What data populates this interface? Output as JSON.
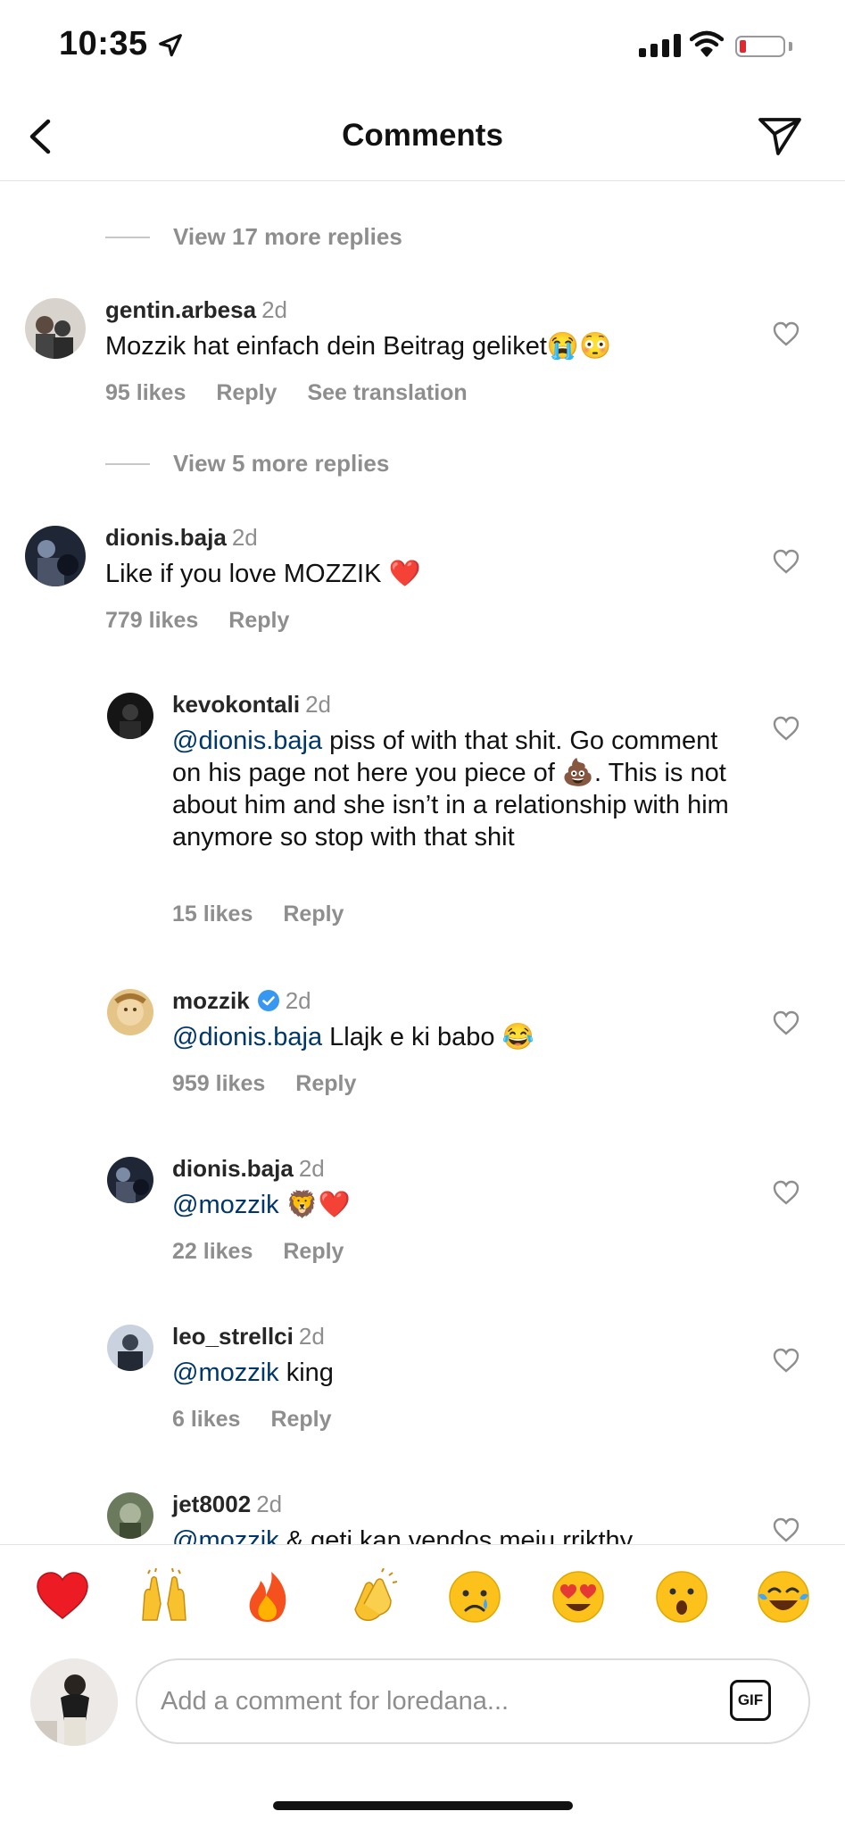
{
  "status": {
    "time": "10:35"
  },
  "header": {
    "title": "Comments"
  },
  "thread": [
    {
      "type": "more",
      "label": "View 17 more replies"
    },
    {
      "type": "comment",
      "username": "gentin.arbesa",
      "time": "2d",
      "text": [
        {
          "t": "Mozzik hat einfach dein Beitrag geliket😭😳"
        }
      ],
      "likes": "95 likes",
      "reply": "Reply",
      "translate": "See translation"
    },
    {
      "type": "more",
      "label": "View 5 more replies"
    },
    {
      "type": "comment",
      "username": "dionis.baja",
      "time": "2d",
      "text": [
        {
          "t": "Like if you love MOZZIK ❤️"
        }
      ],
      "likes": "779 likes",
      "reply": "Reply"
    },
    {
      "type": "reply",
      "username": "kevokontali",
      "time": "2d",
      "text": [
        {
          "t": "@dionis.baja",
          "m": true
        },
        {
          "t": " piss of with that shit. Go comment on his page not here you piece of 💩. This is not about him and she isn’t in a relationship with him anymore so stop with that shit"
        }
      ],
      "likes": "15 likes",
      "reply": "Reply"
    },
    {
      "type": "reply",
      "username": "mozzik",
      "verified": true,
      "time": "2d",
      "text": [
        {
          "t": "@dionis.baja",
          "m": true
        },
        {
          "t": " Llajk e ki babo 😂"
        }
      ],
      "likes": "959 likes",
      "reply": "Reply"
    },
    {
      "type": "reply",
      "username": "dionis.baja",
      "time": "2d",
      "text": [
        {
          "t": "@mozzik",
          "m": true
        },
        {
          "t": " 🦁❤️"
        }
      ],
      "likes": "22 likes",
      "reply": "Reply"
    },
    {
      "type": "reply",
      "username": "leo_strellci",
      "time": "2d",
      "text": [
        {
          "t": "@mozzik",
          "m": true
        },
        {
          "t": " king"
        }
      ],
      "likes": "6 likes",
      "reply": "Reply"
    },
    {
      "type": "reply",
      "username": "jet8002",
      "time": "2d",
      "text": [
        {
          "t": "@mozzik",
          "m": true
        },
        {
          "t": " & geti kan vendos meju rrikthy"
        }
      ]
    }
  ],
  "emoji_bar": [
    "❤️",
    "🙌",
    "🔥",
    "👏",
    "😢",
    "😍",
    "😮",
    "😂"
  ],
  "composer": {
    "placeholder": "Add a comment for loredana...",
    "gif_label": "GIF"
  },
  "colors": {
    "mention": "#00376b",
    "secondary": "#8e8e8e",
    "heart_red": "#ed4956"
  }
}
